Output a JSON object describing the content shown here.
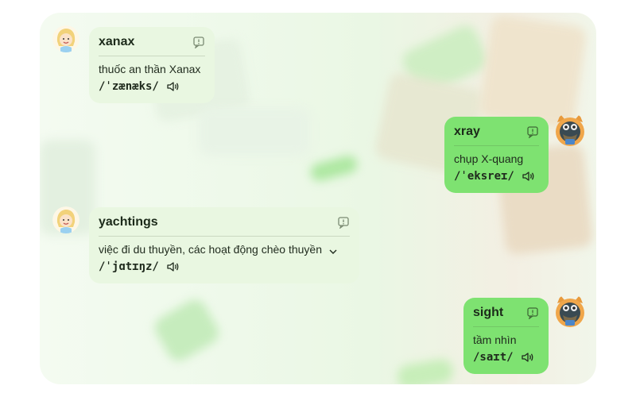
{
  "messages": [
    {
      "side": "left",
      "word": "xanax",
      "meaning": "thuốc an thần Xanax",
      "phonetic": "/ˈzænæks/"
    },
    {
      "side": "right",
      "word": "xray",
      "meaning": "chụp X-quang",
      "phonetic": "/ˈeksreɪ/"
    },
    {
      "side": "left",
      "word": "yachtings",
      "meaning": "việc đi du thuyền, các hoạt động chèo thuyền",
      "phonetic": "/ˈjɑtɪŋz/"
    },
    {
      "side": "right",
      "word": "sight",
      "meaning": "tầm nhìn",
      "phonetic": "/saɪt/"
    }
  ],
  "icons": {
    "note": "note-icon",
    "speaker": "speaker-icon",
    "expand": "chevron-down-icon",
    "bot_avatar": "girl-avatar",
    "user_avatar": "cat-avatar"
  },
  "colors": {
    "left_bubble": "#e9f7e1",
    "right_bubble": "#7ee271",
    "text": "#1f2a1d"
  }
}
